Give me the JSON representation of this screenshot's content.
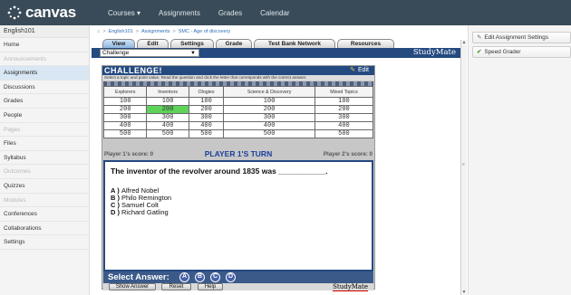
{
  "header": {
    "logo": "canvas",
    "nav": [
      "Courses ▾",
      "Assignments",
      "Grades",
      "Calendar"
    ]
  },
  "sidebar": {
    "course": "English101",
    "items": [
      {
        "label": "Home",
        "state": "normal"
      },
      {
        "label": "Announcements",
        "state": "disabled"
      },
      {
        "label": "Assignments",
        "state": "selected"
      },
      {
        "label": "Discussions",
        "state": "normal"
      },
      {
        "label": "Grades",
        "state": "normal"
      },
      {
        "label": "People",
        "state": "normal"
      },
      {
        "label": "Pages",
        "state": "disabled"
      },
      {
        "label": "Files",
        "state": "normal"
      },
      {
        "label": "Syllabus",
        "state": "normal"
      },
      {
        "label": "Outcomes",
        "state": "disabled"
      },
      {
        "label": "Quizzes",
        "state": "normal"
      },
      {
        "label": "Modules",
        "state": "disabled"
      },
      {
        "label": "Conferences",
        "state": "normal"
      },
      {
        "label": "Collaborations",
        "state": "normal"
      },
      {
        "label": "Settings",
        "state": "normal"
      }
    ]
  },
  "breadcrumb": [
    "English101",
    "Assignments",
    "SMC - Age of discovery"
  ],
  "tabs": [
    "View",
    "Edit",
    "Settings",
    "Grade",
    "Test Bank Network",
    "Resources"
  ],
  "mode_select": {
    "value": "Challenge"
  },
  "studymate_label": "StudyMate",
  "game": {
    "title": "CHALLENGE!",
    "edit_label": "Edit",
    "instructions": "Select a topic and point value. Read the question and click the letter that corresponds with the correct answer.",
    "columns": [
      "Explorers",
      "Inventors",
      "Ologies",
      "Science & Discovery",
      "Mixed Topics"
    ],
    "rows": [
      [
        "100",
        "100",
        "100",
        "100",
        "100"
      ],
      [
        "200",
        "200",
        "200",
        "200",
        "200"
      ],
      [
        "300",
        "300",
        "300",
        "300",
        "300"
      ],
      [
        "400",
        "400",
        "400",
        "400",
        "400"
      ],
      [
        "500",
        "500",
        "500",
        "500",
        "500"
      ]
    ],
    "highlight": {
      "row": 1,
      "col": 1
    },
    "player1_score": "Player 1's score: 0",
    "turn": "PLAYER 1'S TURN",
    "player2_score": "Player 2's score: 0",
    "question": "The inventor of the revolver around 1835 was ___________.",
    "answers": [
      {
        "letter": "A )",
        "text": "Alfred Nobel"
      },
      {
        "letter": "B )",
        "text": "Philo Remington"
      },
      {
        "letter": "C )",
        "text": "Samuel Colt"
      },
      {
        "letter": "D )",
        "text": "Richard Gatling"
      }
    ],
    "select_answer_label": "Select Answer:",
    "answer_buttons": [
      "A",
      "B",
      "C",
      "D"
    ],
    "show_answer_label": "Show Answer",
    "reset_label": "Reset",
    "help_label": "Help",
    "logo": "StudyMate"
  },
  "right_panel": {
    "edit_settings": "Edit Assignment Settings",
    "speed_grader": "Speed Grader"
  },
  "colors": {
    "header_bg": "#394b58",
    "game_blue": "#244a80",
    "highlight_green": "#5fd25a",
    "turn_blue": "#1b3f9c"
  }
}
